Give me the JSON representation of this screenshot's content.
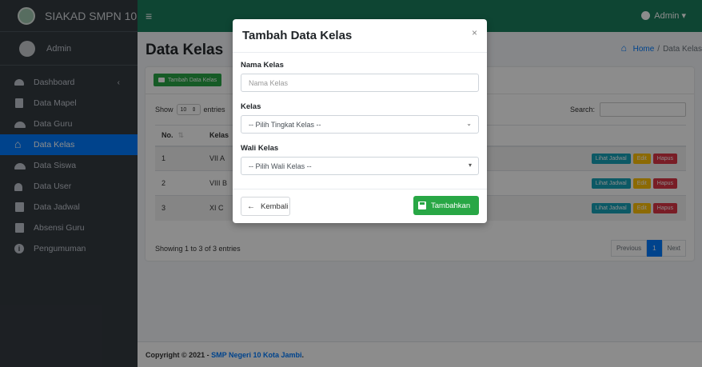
{
  "sidebar": {
    "brand": "SIAKAD SMPN 10",
    "user": "Admin",
    "items": [
      {
        "label": "Dashboard",
        "icon": "dashboard-icon"
      },
      {
        "label": "Data Mapel",
        "icon": "book-icon"
      },
      {
        "label": "Data Guru",
        "icon": "users-icon"
      },
      {
        "label": "Data Kelas",
        "icon": "home-icon",
        "active": true
      },
      {
        "label": "Data Siswa",
        "icon": "users-icon"
      },
      {
        "label": "Data User",
        "icon": "user-plus-icon"
      },
      {
        "label": "Data Jadwal",
        "icon": "calendar-icon"
      },
      {
        "label": "Absensi Guru",
        "icon": "calendar-check-icon"
      },
      {
        "label": "Pengumuman",
        "icon": "info-icon"
      }
    ]
  },
  "topbar": {
    "hamburger": "≡",
    "admin": "Admin ▾"
  },
  "page": {
    "title": "Data Kelas",
    "breadcrumb": {
      "home": "Home",
      "sep": "/",
      "current": "Data Kelas"
    }
  },
  "table_controls": {
    "add_button": "Tambah Data Kelas",
    "show": "Show",
    "length_value": "10",
    "entries": "entries",
    "search_label": "Search:"
  },
  "table": {
    "headers": {
      "no": "No.",
      "kelas": "Kelas"
    },
    "rows": [
      {
        "no": "1",
        "kelas": "VII A"
      },
      {
        "no": "2",
        "kelas": "VIII B"
      },
      {
        "no": "3",
        "kelas": "XI C"
      }
    ],
    "actions": {
      "view": "Lihat Jadwal",
      "edit": "Edit",
      "delete": "Hapus"
    }
  },
  "info": "Showing 1 to 3 of 3 entries",
  "pagination": {
    "previous": "Previous",
    "page": "1",
    "next": "Next"
  },
  "footer": {
    "prefix": "Copyright © 2021 - ",
    "link": "SMP Negeri 10 Kota Jambi",
    "suffix": "."
  },
  "modal": {
    "title": "Tambah Data Kelas",
    "close": "×",
    "nama_label": "Nama Kelas",
    "nama_placeholder": "Nama Kelas",
    "kelas_label": "Kelas",
    "kelas_value": "-- Pilih Tingkat Kelas --",
    "wali_label": "Wali Kelas",
    "wali_value": "-- Pilih Wali Kelas --",
    "back_button": "Kembali",
    "submit_button": "Tambahkan"
  },
  "colors": {
    "header": "#1a7f5e",
    "sidebar": "#343b41",
    "primary": "#007bff",
    "success": "#28a745",
    "danger": "#dc3545",
    "warning": "#ffc107",
    "info": "#17a2b8"
  }
}
